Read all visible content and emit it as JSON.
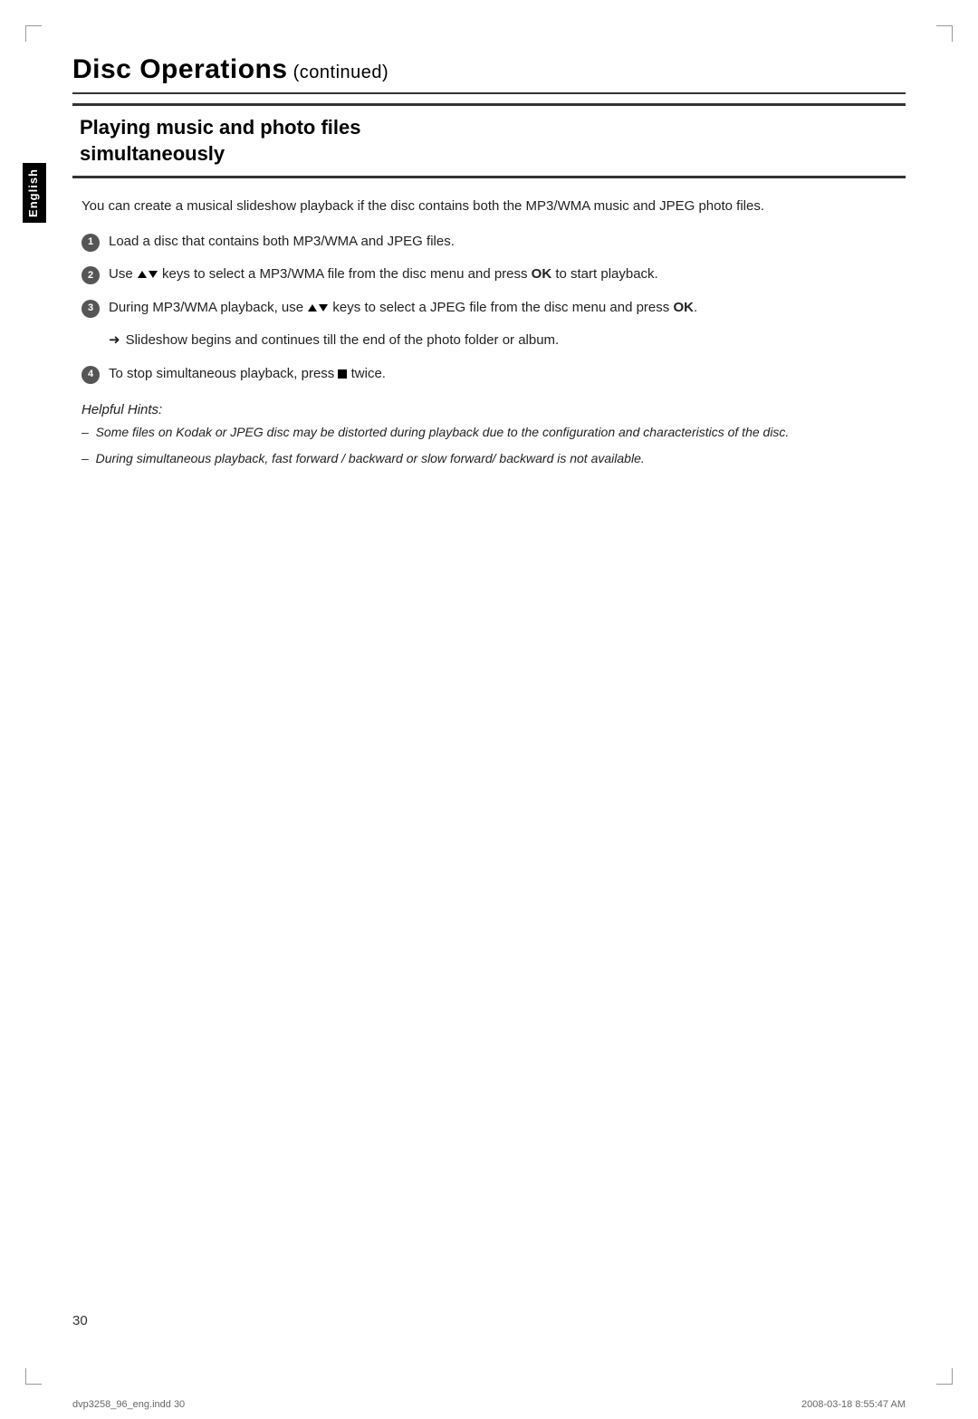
{
  "page": {
    "title": "Disc Operations",
    "title_continued": " (continued)",
    "page_number": "30"
  },
  "sidebar": {
    "language_label": "English"
  },
  "section": {
    "title_line1": "Playing music and photo files",
    "title_line2": "simultaneously"
  },
  "intro_text": "You can create a musical slideshow playback if the disc contains both the MP3/WMA music and JPEG photo files.",
  "steps": [
    {
      "number": "1",
      "text": "Load a disc that contains both MP3/WMA and JPEG files."
    },
    {
      "number": "2",
      "text_before": "Use ",
      "arrows": "▲▼",
      "text_after": " keys to select a MP3/WMA file from the disc menu and press ",
      "ok_bold": "OK",
      "text_end": " to start playback."
    },
    {
      "number": "3",
      "text_before": "During MP3/WMA playback, use ",
      "arrows": "▲▼",
      "text_after": " keys to select a JPEG file from the disc menu and press ",
      "ok_bold": "OK",
      "text_end": "."
    },
    {
      "number": "4",
      "text_before": "To stop simultaneous playback, press ",
      "stop": "■",
      "text_end": " twice."
    }
  ],
  "arrow_note": "Slideshow begins and continues till the end of the photo folder or album.",
  "hints": {
    "title": "Helpful Hints:",
    "items": [
      "Some files on Kodak or JPEG disc may be distorted during playback due to the configuration and characteristics of the disc.",
      "During simultaneous playback, fast forward / backward or slow forward/ backward is not available."
    ]
  },
  "footer": {
    "left": "dvp3258_96_eng.indd  30",
    "right": "2008-03-18   8:55:47 AM"
  }
}
